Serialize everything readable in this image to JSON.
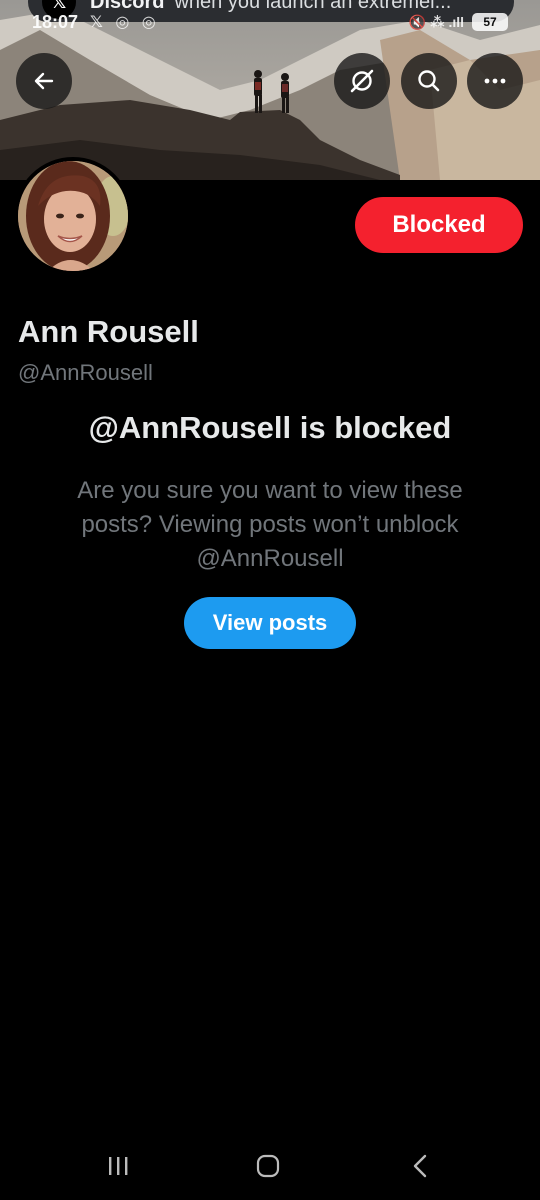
{
  "notification": {
    "app_icon": "x-logo",
    "app_name": "Discord",
    "message": "when you launch an extremel..."
  },
  "status_bar": {
    "time": "18:07",
    "left_icons": "𝕏 ◎ ◎",
    "right_icons": "🔇 ⁂ .ıll",
    "battery": "57"
  },
  "header_actions": {
    "back_icon": "arrow-left-icon",
    "grok_icon": "grok-icon",
    "search_icon": "search-icon",
    "more_icon": "more-horizontal-icon"
  },
  "profile": {
    "display_name": "Ann Rousell",
    "handle": "@AnnRousell",
    "blocked_button_label": "Blocked"
  },
  "blocked_notice": {
    "title": "@AnnRousell is blocked",
    "message": "Are you sure you want to view these posts? Viewing posts won’t unblock @AnnRousell",
    "view_button_label": "View posts"
  },
  "colors": {
    "background": "#000000",
    "blocked_red": "#f4212e",
    "accent_blue": "#1d9bf0",
    "secondary_text": "#71767b",
    "primary_text": "#e7e9ea"
  },
  "system_nav": {
    "recent_icon": "recent-apps-icon",
    "home_icon": "home-icon",
    "back_icon": "system-back-icon"
  }
}
